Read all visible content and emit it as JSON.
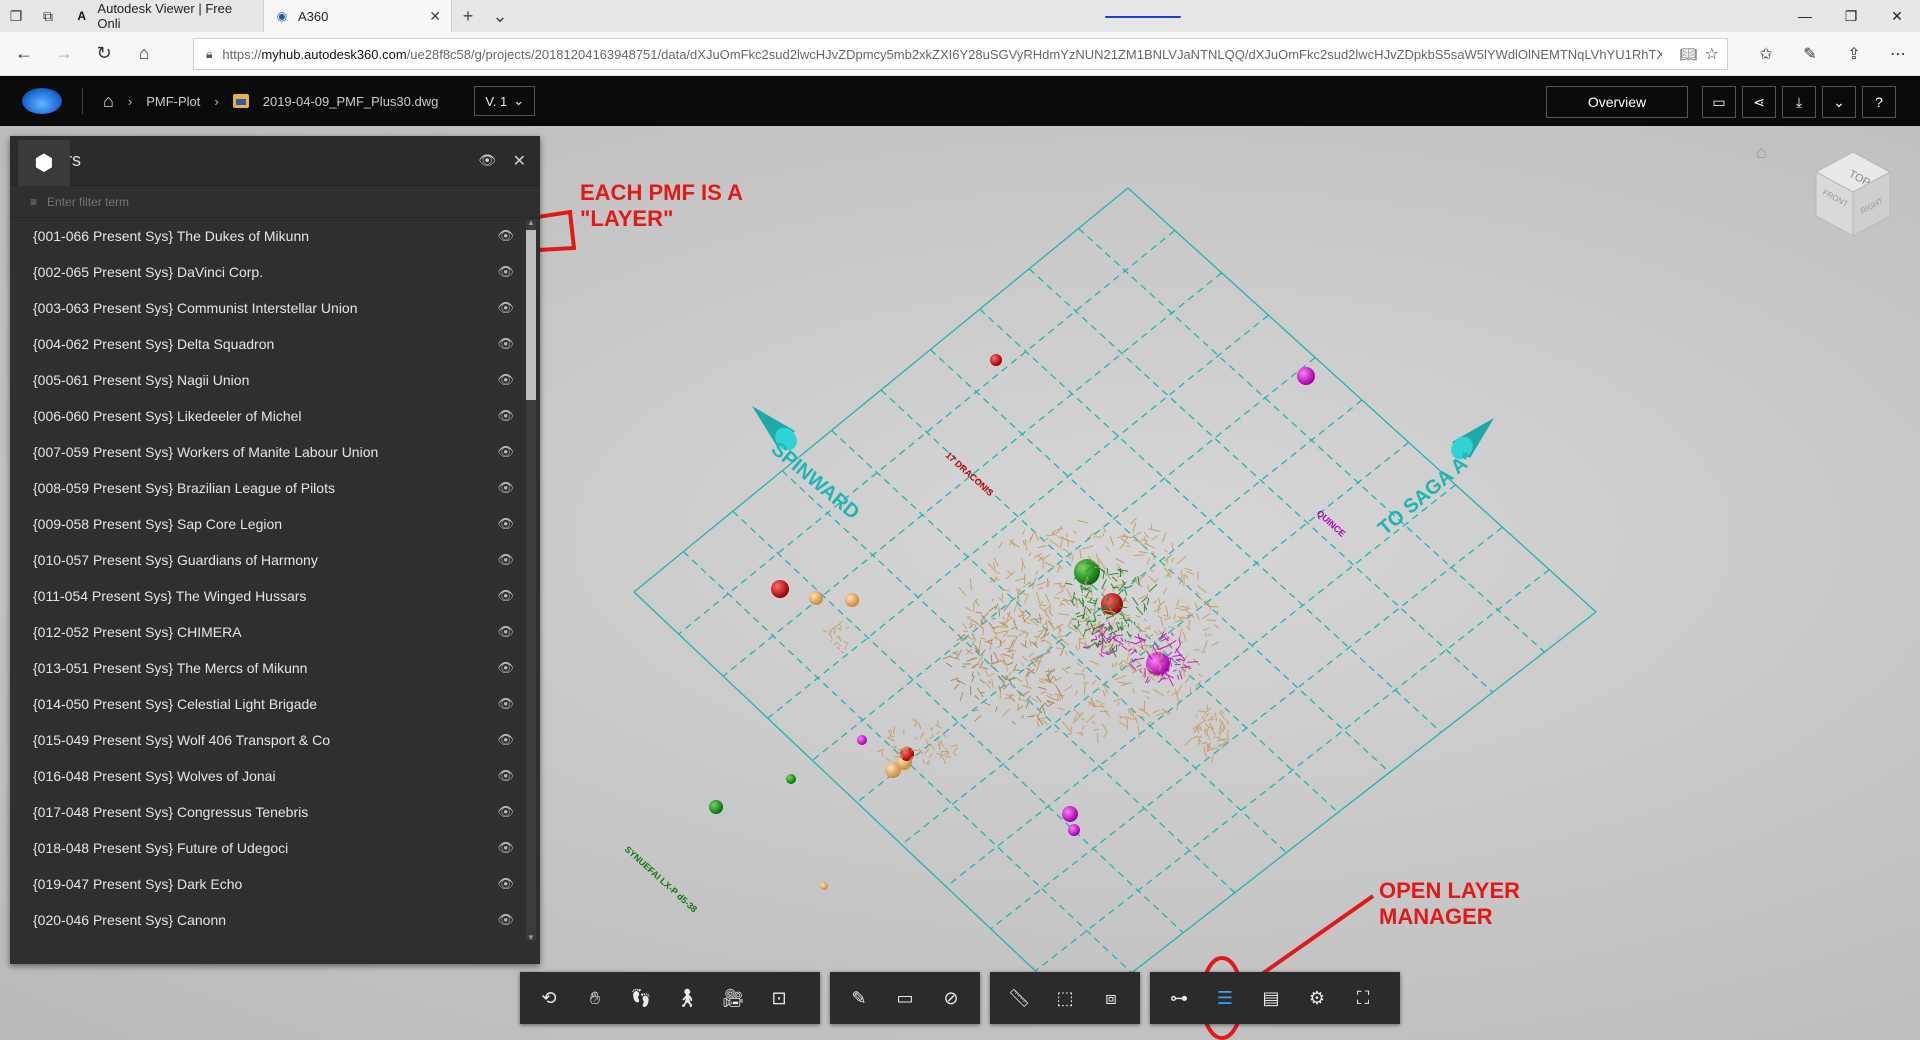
{
  "browser": {
    "tabs": [
      {
        "title": "Autodesk Viewer | Free Onli",
        "active": false
      },
      {
        "title": "A360",
        "active": true
      }
    ],
    "url_prefix": "https://",
    "url_host": "myhub.autodesk360.com",
    "url_path": "/ue28f8c58/g/projects/20181204163948751/data/dXJuOmFkc2sud2lwcHJvZDpmcy5mb2xkZXI6Y28uSGVyRHdmYzNUN21ZM1BNLVJaNTNLQQ/dXJuOmFkc2sud2lwcHJvZDpkbS5saW5lYWdlOlNEMTNqLVhYU1RhTXo1S"
  },
  "header": {
    "project": "PMF-Plot",
    "file": "2019-04-09_PMF_Plus30.dwg",
    "version": "V. 1",
    "overview_label": "Overview"
  },
  "layers_panel": {
    "title": "ers",
    "filter_placeholder": "Enter filter term",
    "layers": [
      "{001-066 Present Sys} The Dukes of Mikunn",
      "{002-065 Present Sys} DaVinci Corp.",
      "{003-063 Present Sys} Communist Interstellar Union",
      "{004-062 Present Sys} Delta Squadron",
      "{005-061 Present Sys} Nagii Union",
      "{006-060 Present Sys} Likedeeler of Michel",
      "{007-059 Present Sys} Workers of Manite Labour Union",
      "{008-059 Present Sys} Brazilian League of Pilots",
      "{009-058 Present Sys} Sap Core Legion",
      "{010-057 Present Sys} Guardians of Harmony",
      "{011-054 Present Sys} The Winged Hussars",
      "{012-052 Present Sys} CHIMERA",
      "{013-051 Present Sys} The Mercs of Mikunn",
      "{014-050 Present Sys} Celestial Light Brigade",
      "{015-049 Present Sys} Wolf 406 Transport & Co",
      "{016-048 Present Sys} Wolves of Jonai",
      "{017-048 Present Sys} Congressus Tenebris",
      "{018-048 Present Sys} Future of Udegoci",
      "{019-047 Present Sys} Dark Echo",
      "{020-046 Present Sys} Canonn"
    ]
  },
  "annotations": {
    "layer_note_line1": "EACH PMF IS A",
    "layer_note_line2": "\"LAYER\"",
    "manager_note_line1": "OPEN LAYER",
    "manager_note_line2": "MANAGER"
  },
  "scene_labels": {
    "spinward": "SPINWARD",
    "to_saga": "TO SAGA A*",
    "dragons": "17 DRACONIS",
    "quince": "QUINCE",
    "synuefai": "SYNUEFAI LX-P d5-38",
    "viewcube_top": "TOP",
    "viewcube_front": "FRONT",
    "viewcube_right": "RIGHT"
  },
  "colors": {
    "grid": "#1fb5b5",
    "annotation": "#e11919",
    "active_tool": "#3aa0ff"
  },
  "toolbar": {
    "icons": [
      "orbit-icon",
      "pan-icon",
      "walk-icon",
      "first-person-icon",
      "camera-icon",
      "fit-to-view-icon",
      "markup-icon",
      "comment-icon",
      "hide-icon",
      "measure-icon",
      "section-icon",
      "explode-icon",
      "model-browser-icon",
      "layers-icon",
      "properties-icon",
      "settings-icon",
      "fullscreen-icon"
    ]
  }
}
